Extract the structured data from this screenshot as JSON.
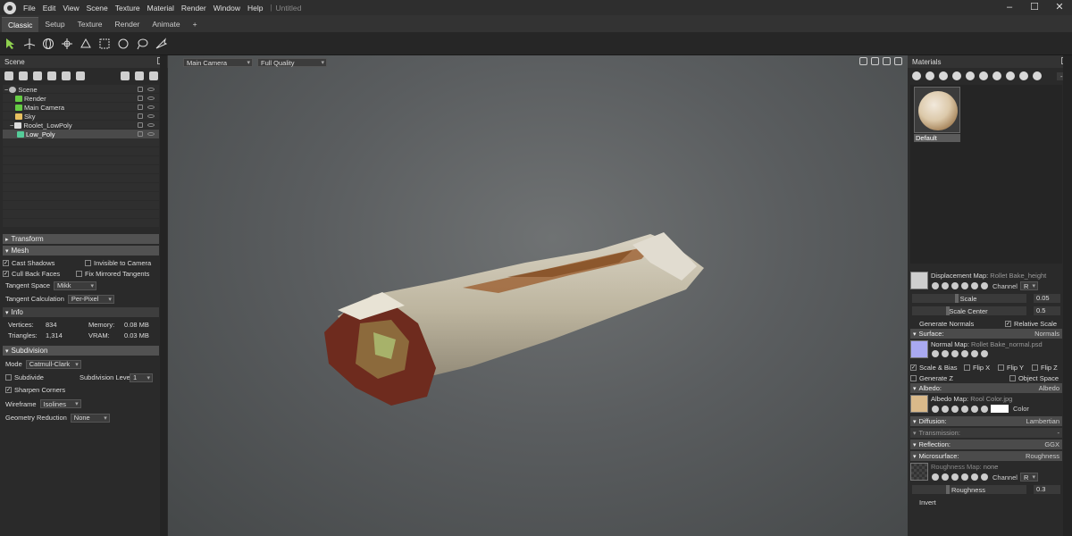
{
  "menu": [
    "File",
    "Edit",
    "View",
    "Scene",
    "Texture",
    "Material",
    "Render",
    "Window",
    "Help"
  ],
  "doc_title": "Untitled",
  "tabs": [
    "Classic",
    "Setup",
    "Texture",
    "Render",
    "Animate",
    "+"
  ],
  "scene": {
    "title": "Scene",
    "tree": [
      {
        "label": "Scene",
        "color": "#bbbbbb"
      },
      {
        "label": "Render",
        "color": "#66cc44"
      },
      {
        "label": "Main Camera",
        "color": "#66cc44"
      },
      {
        "label": "Sky",
        "color": "#e8c060"
      },
      {
        "label": "Roolet_LowPoly",
        "color": "#dddddd"
      },
      {
        "label": "Low_Poly",
        "color": "#55cc99"
      }
    ],
    "transform": "Transform",
    "mesh": "Mesh",
    "cast_shadows": "Cast Shadows",
    "invisible_to_camera": "Invisible to Camera",
    "cull_back_faces": "Cull Back Faces",
    "fix_mirrored": "Fix Mirrored Tangents",
    "tangent_space_label": "Tangent Space",
    "tangent_space_value": "Mikk",
    "tangent_calc_label": "Tangent Calculation",
    "tangent_calc_value": "Per-Pixel",
    "info": "Info",
    "vertices_label": "Vertices:",
    "vertices": "834",
    "triangles_label": "Triangles:",
    "triangles": "1,314",
    "memory_label": "Memory:",
    "memory": "0.08 MB",
    "vram_label": "VRAM:",
    "vram": "0.03 MB",
    "subdivision": "Subdivision",
    "mode_label": "Mode",
    "mode_value": "Catmull-Clark",
    "subdivide": "Subdivide",
    "subdiv_level_label": "Subdivision Level",
    "subdiv_level": "1",
    "sharpen": "Sharpen Corners",
    "wireframe_label": "Wireframe",
    "wireframe_value": "Isolines",
    "geo_reduction_label": "Geometry Reduction",
    "geo_reduction_value": "None"
  },
  "viewport": {
    "camera": "Main Camera",
    "quality": "Full Quality"
  },
  "materials": {
    "title": "Materials",
    "counter": "- /",
    "default_name": "Default",
    "displacement_map": "Displacement Map:",
    "displacement_file": "Rollet Bake_height",
    "channel_label": "Channel",
    "channel_value": "R",
    "scale_label": "Scale",
    "scale_value": "0.05",
    "scale_center_label": "Scale Center",
    "scale_center_value": "0.5",
    "generate_normals": "Generate Normals",
    "relative_scale": "Relative Scale",
    "surface_label": "Surface:",
    "surface_value": "Normals",
    "normal_map": "Normal Map:",
    "normal_file": "Rollet Bake_normal.psd",
    "scale_bias": "Scale & Bias",
    "flip_x": "Flip X",
    "flip_y": "Flip Y",
    "flip_z": "Flip Z",
    "generate_z": "Generate Z",
    "object_space": "Object Space",
    "albedo_label": "Albedo:",
    "albedo_value": "Albedo",
    "albedo_map": "Albedo Map:",
    "albedo_file": "Rool Color.jpg",
    "color_label": "Color",
    "diffusion_label": "Diffusion:",
    "diffusion_value": "Lambertian",
    "transmission_label": "Transmission:",
    "transmission_value": "-",
    "reflection_label": "Reflection:",
    "reflection_value": "GGX",
    "microsurface_label": "Microsurface:",
    "microsurface_value": "Roughness",
    "roughness_map": "Roughness Map:",
    "roughness_file": "none",
    "roughness_label": "Roughness",
    "roughness_value": "0.3",
    "invert": "Invert"
  }
}
